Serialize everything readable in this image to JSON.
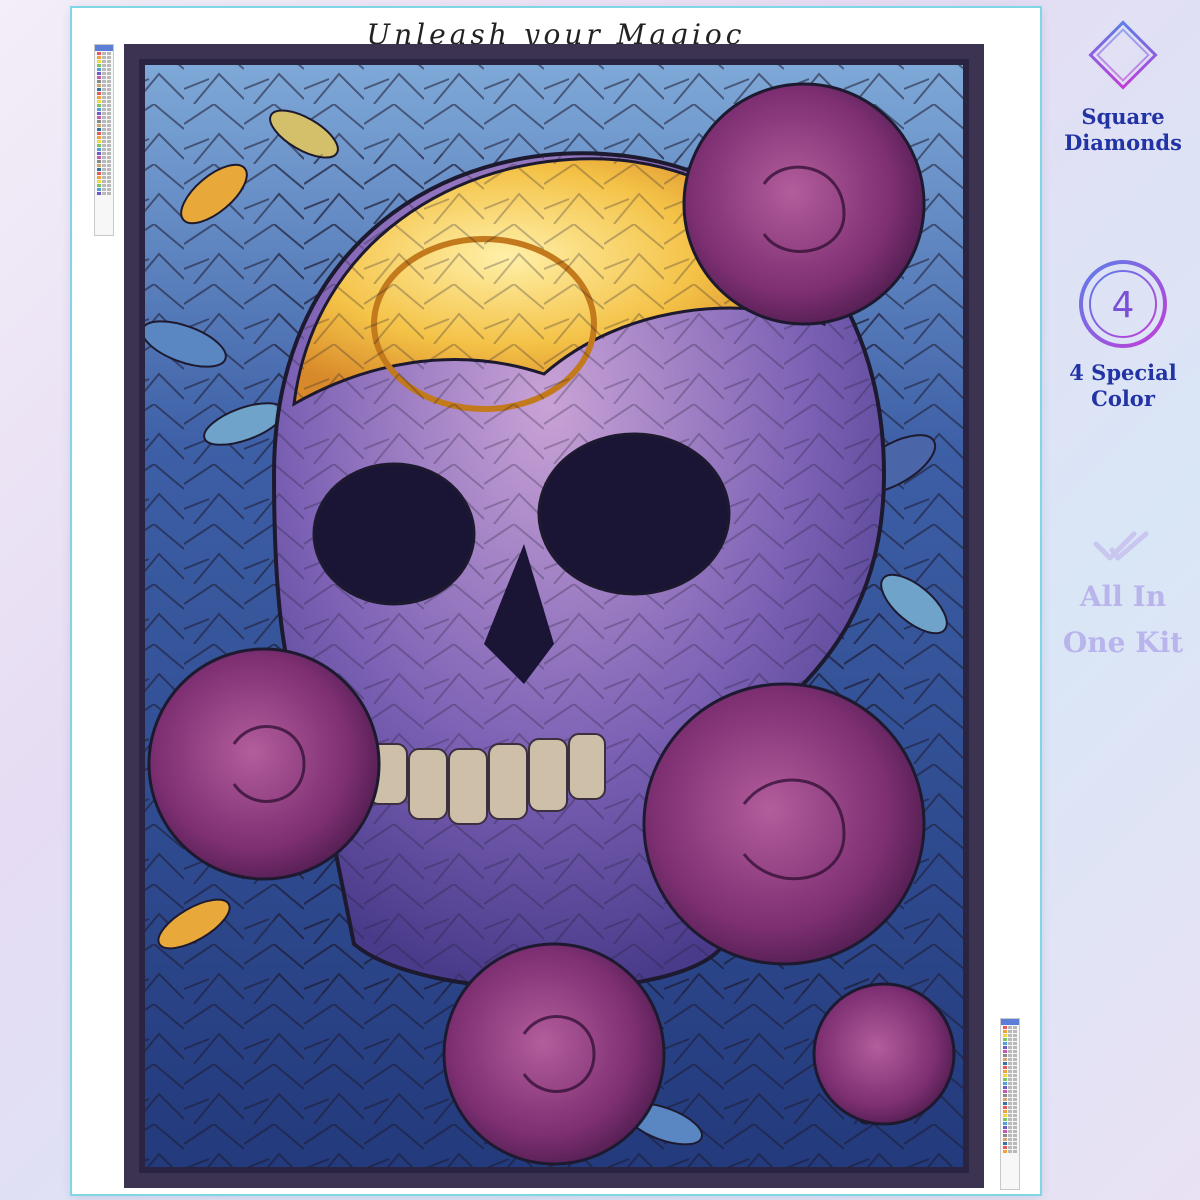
{
  "banner": {
    "text": "Unleash your Magioc"
  },
  "features": [
    {
      "icon": "diamond-outline-icon",
      "label": "Square Diamonds"
    },
    {
      "icon": "number-circle-icon",
      "icon_text": "4",
      "label": "4 Special Color"
    },
    {
      "icon": "double-check-icon",
      "label": "All In One Kit"
    }
  ],
  "colors": {
    "accent": "#2233a6",
    "frame": "#3b3350",
    "faded": "#b9b4ec",
    "icon_gradient": [
      "#5b7fe8",
      "#c23ed8"
    ]
  }
}
